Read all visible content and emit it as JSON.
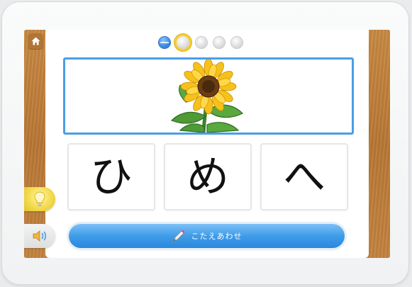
{
  "app": {
    "home_icon": "home-icon",
    "accent_color": "#3f9ce9"
  },
  "progress": {
    "total": 5,
    "current_index": 1,
    "completed": 1
  },
  "question": {
    "picture": "sunflower-illustration"
  },
  "choices": [
    {
      "label": "ひ"
    },
    {
      "label": "め"
    },
    {
      "label": "へ"
    }
  ],
  "side_buttons": {
    "hint_icon": "lightbulb-icon",
    "sound_icon": "speaker-icon"
  },
  "answer_button": {
    "label": "こたえあわせ",
    "icon": "pencil-icon"
  }
}
